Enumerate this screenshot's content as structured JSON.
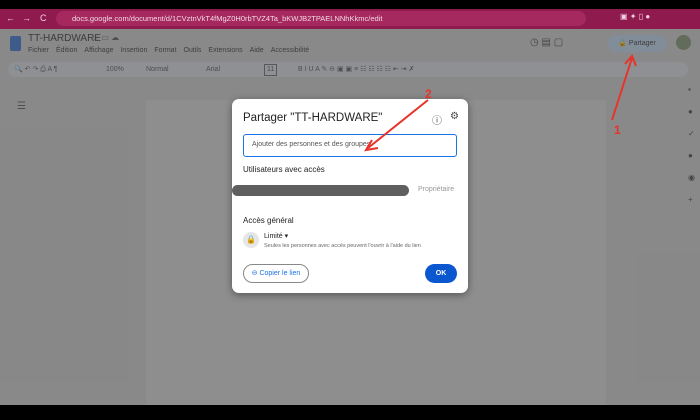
{
  "browser": {
    "url": "docs.google.com/document/d/1CVztnVkT4fMgZ0H0rbTVZ4Ta_bKWJB2TPAELNNhKkmc/edit",
    "back": "←",
    "forward": "→",
    "reload": "C"
  },
  "doc": {
    "title": "TT-HARDWARE",
    "menu": [
      "Fichier",
      "Édition",
      "Affichage",
      "Insertion",
      "Format",
      "Outils",
      "Extensions",
      "Aide",
      "Accessibilité"
    ],
    "share_label": "Partager"
  },
  "toolbar": {
    "zoom": "100%",
    "style": "Normal",
    "font": "Arial",
    "size": "11"
  },
  "dialog": {
    "title": "Partager \"TT-HARDWARE\"",
    "input_placeholder": "Ajouter des personnes et des groupes",
    "users_heading": "Utilisateurs avec accès",
    "owner_role": "Propriétaire",
    "general_heading": "Accès général",
    "access_level": "Limité",
    "access_desc": "Seules les personnes avec accès peuvent l'ouvrir à l'aide du lien",
    "copy_link": "Copier le lien",
    "ok": "OK"
  },
  "annotations": {
    "one": "1",
    "two": "2"
  },
  "colors": {
    "browser": "#8e1a4e",
    "accent": "#1a73e8",
    "ok": "#0b57d0",
    "arrow": "#e8332a"
  }
}
